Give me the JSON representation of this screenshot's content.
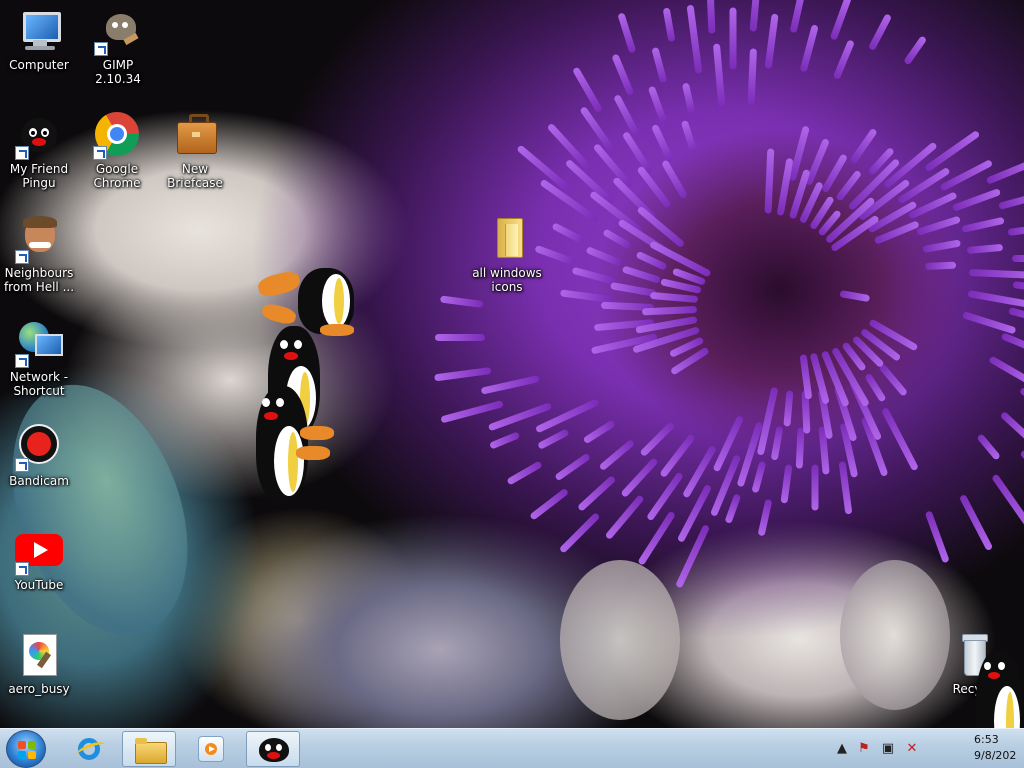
{
  "desktop": {
    "icons": [
      {
        "id": "computer",
        "label": "Computer",
        "icon": "computer-icon",
        "shortcut": false
      },
      {
        "id": "gimp",
        "label": "GIMP 2.10.34",
        "icon": "gimp-icon",
        "shortcut": true
      },
      {
        "id": "my-friend-pingu",
        "label": "My Friend Pingu",
        "icon": "pingu-icon",
        "shortcut": true
      },
      {
        "id": "google-chrome",
        "label": "Google Chrome",
        "icon": "chrome-icon",
        "shortcut": true
      },
      {
        "id": "new-briefcase",
        "label": "New Briefcase",
        "icon": "briefcase-icon",
        "shortcut": false
      },
      {
        "id": "neighbours",
        "label": "Neighbours from Hell ...",
        "icon": "neighbours-icon",
        "shortcut": true
      },
      {
        "id": "all-windows-icons",
        "label": "all windows icons",
        "icon": "folder-icon",
        "shortcut": false
      },
      {
        "id": "network-shortcut",
        "label": "Network - Shortcut",
        "icon": "network-icon",
        "shortcut": true
      },
      {
        "id": "bandicam",
        "label": "Bandicam",
        "icon": "bandicam-icon",
        "shortcut": true
      },
      {
        "id": "youtube",
        "label": "YouTube",
        "icon": "youtube-icon",
        "shortcut": true
      },
      {
        "id": "aero-busy",
        "label": "aero_busy",
        "icon": "paint-file-icon",
        "shortcut": false
      },
      {
        "id": "recycle-bin",
        "label": "Recycl",
        "icon": "recycle-bin-icon",
        "shortcut": false
      }
    ]
  },
  "taskbar": {
    "start": {
      "icon": "windows-start-icon"
    },
    "pinned": [
      {
        "id": "ie",
        "icon": "internet-explorer-icon",
        "active": false
      },
      {
        "id": "explorer",
        "icon": "folder-explorer-icon",
        "active": true
      },
      {
        "id": "media",
        "icon": "media-player-icon",
        "active": false
      },
      {
        "id": "pingu",
        "icon": "pingu-icon",
        "active": true
      }
    ],
    "tray": {
      "icons": [
        "show-hidden-icons-chevron",
        "action-center-flag-icon",
        "network-icon",
        "volume-muted-icon"
      ],
      "time": "6:53",
      "date": "9/8/202"
    }
  },
  "colors": {
    "taskbar": "#b7cde2",
    "wallpaper_purple": "#8c3cc4"
  }
}
